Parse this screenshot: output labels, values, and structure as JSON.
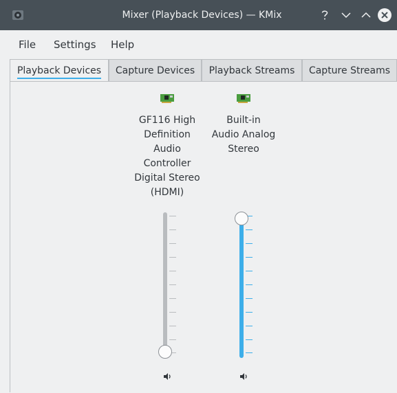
{
  "window": {
    "title": "Mixer (Playback Devices) — KMix"
  },
  "menubar": {
    "items": [
      {
        "label": "File"
      },
      {
        "label": "Settings"
      },
      {
        "label": "Help"
      }
    ]
  },
  "tabs": [
    {
      "label": "Playback Devices",
      "active": true
    },
    {
      "label": "Capture Devices",
      "active": false
    },
    {
      "label": "Playback Streams",
      "active": false
    },
    {
      "label": "Capture Streams",
      "active": false
    }
  ],
  "devices": [
    {
      "name_lines": [
        "GF116 High",
        "Definition",
        "Audio",
        "Controller",
        "Digital Stereo",
        "(HDMI)"
      ],
      "volume_fraction": 0.0,
      "icon": "sound-card-icon",
      "mute_icon": "speaker-icon"
    },
    {
      "name_lines": [
        "Built-in",
        "Audio Analog",
        "Stereo"
      ],
      "volume_fraction": 1.0,
      "icon": "sound-card-icon",
      "mute_icon": "speaker-icon"
    }
  ],
  "colors": {
    "titlebar": "#475057",
    "accent": "#3daee9",
    "track_inactive": "#b9bcbf",
    "background": "#eff0f1"
  }
}
